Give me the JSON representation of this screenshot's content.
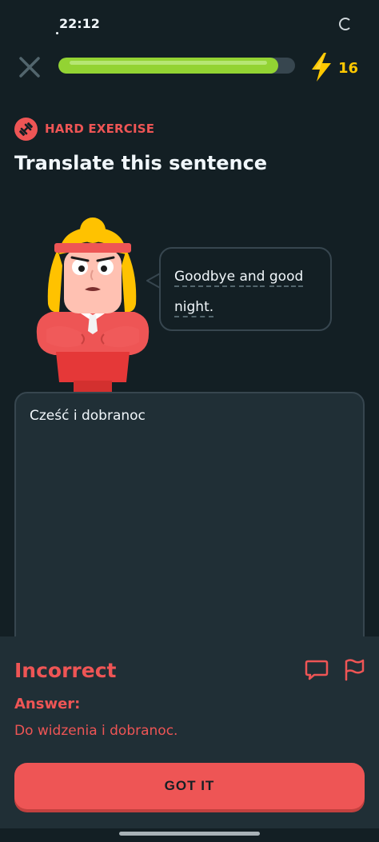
{
  "status_bar": {
    "time": "22:12"
  },
  "header": {
    "progress_fraction": 0.93,
    "energy_count": "16"
  },
  "exercise": {
    "badge": "HARD EXERCISE",
    "title": "Translate this sentence"
  },
  "prompt": {
    "line1_words": [
      "Goodbye",
      "and",
      "good"
    ],
    "line2_words": [
      "night."
    ]
  },
  "answer_input": {
    "value": "Cześć i dobranoc"
  },
  "feedback": {
    "title": "Incorrect",
    "answer_label": "Answer:",
    "answer_value": "Do widzenia i dobranoc.",
    "button_label": "GOT IT"
  },
  "colors": {
    "background": "#131f24",
    "progress": "#93d333",
    "energy": "#ffc800",
    "error": "#ee5555",
    "panel": "#202f36"
  },
  "icons": [
    "close-icon",
    "lightning-icon",
    "dumbbell-icon",
    "report-icon",
    "flag-icon"
  ]
}
